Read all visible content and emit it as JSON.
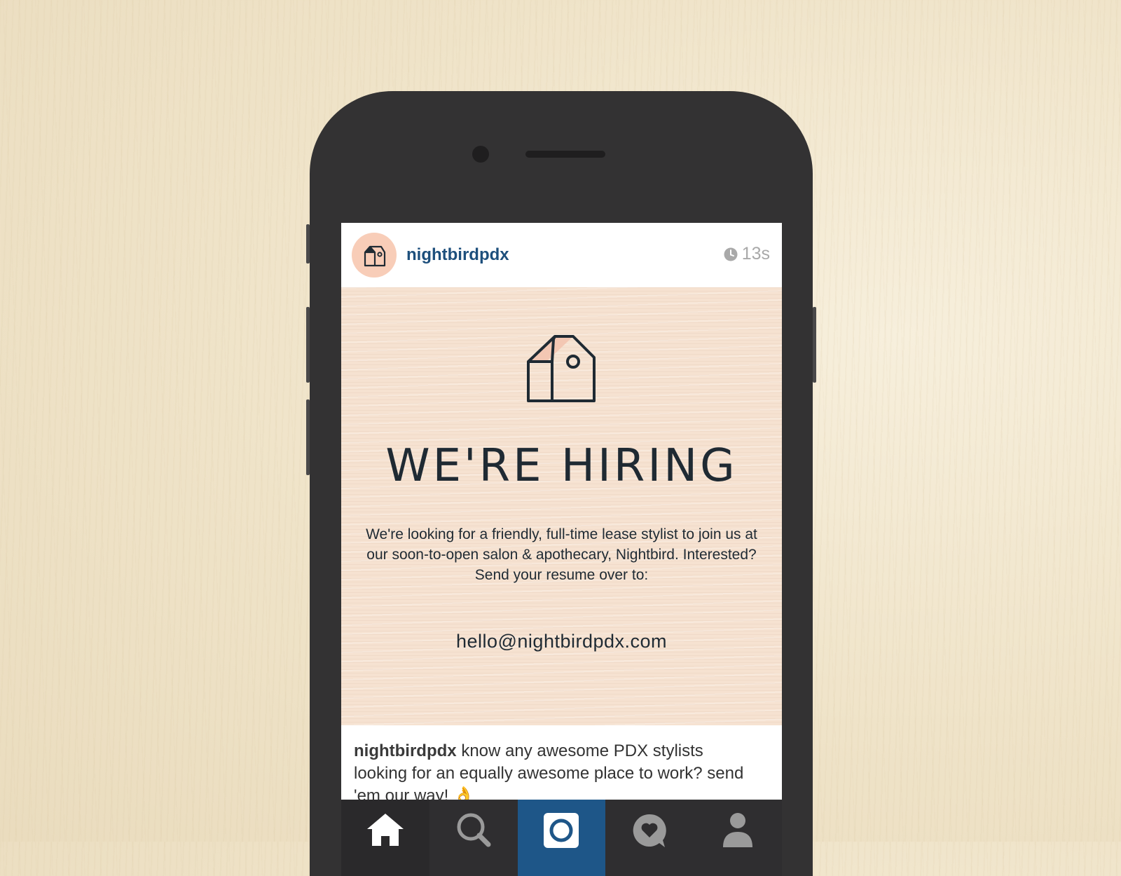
{
  "post": {
    "username": "nightbirdpdx",
    "time_ago": "13s",
    "image": {
      "heading": "WE'RE HIRING",
      "body": "We're looking for a friendly, full-time lease stylist to join us at our soon-to-open salon & apothecary, Nightbird. Interested? Send your resume over to:",
      "email": "hello@nightbirdpdx.com"
    },
    "caption_user": "nightbirdpdx",
    "caption_text": "know any awesome PDX stylists looking for an equally awesome place to work? send 'em our way! 👌"
  },
  "tabs": [
    {
      "name": "home",
      "icon": "home-icon"
    },
    {
      "name": "explore",
      "icon": "search-icon"
    },
    {
      "name": "camera",
      "icon": "camera-icon"
    },
    {
      "name": "activity",
      "icon": "heart-bubble-icon"
    },
    {
      "name": "profile",
      "icon": "profile-icon"
    }
  ],
  "colors": {
    "username": "#1d4f7c",
    "avatar_bg": "#f8cdb8",
    "camera_tab": "#1e5688",
    "phone_body": "#333233"
  }
}
